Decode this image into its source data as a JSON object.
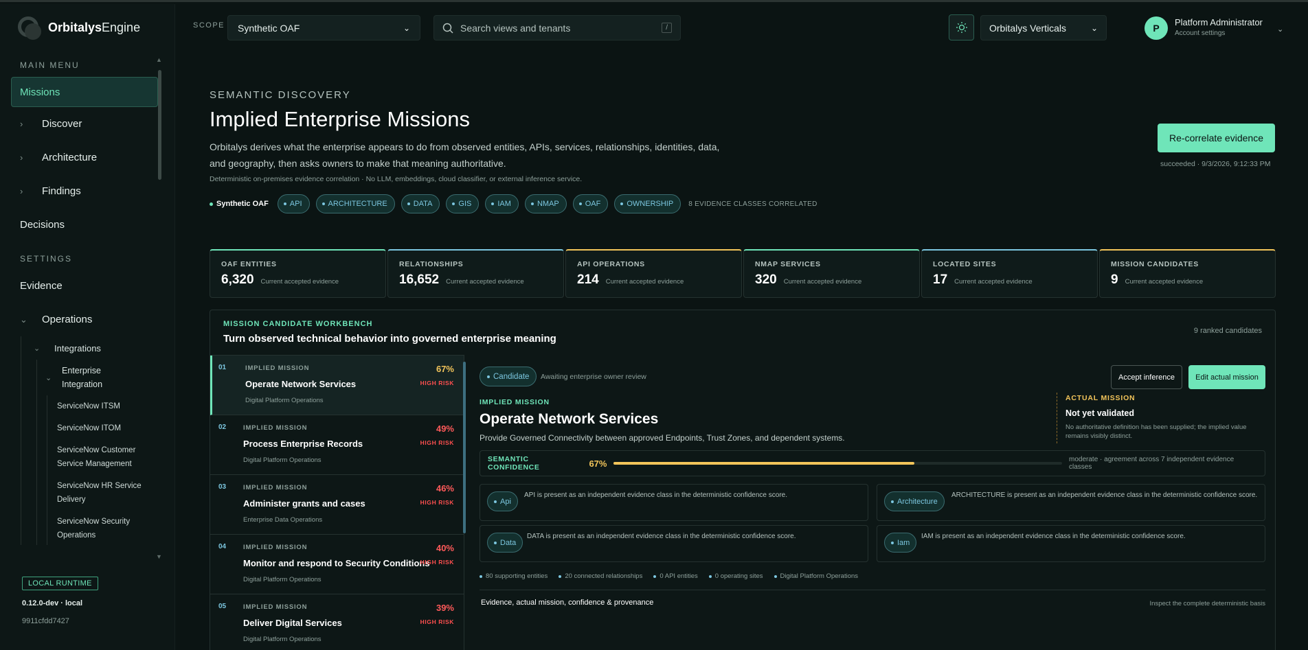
{
  "app": {
    "brand_bold": "Orbitalys",
    "brand_light": "Engine"
  },
  "sidebar": {
    "main_menu_label": "MAIN MENU",
    "settings_label": "SETTINGS",
    "items_main": [
      {
        "label": "Missions",
        "active": true
      },
      {
        "label": "Discover"
      },
      {
        "label": "Architecture"
      },
      {
        "label": "Findings"
      },
      {
        "label": "Decisions"
      }
    ],
    "evidence": "Evidence",
    "operations": "Operations",
    "integrations": "Integrations",
    "enterprise_integration": "Enterprise Integration",
    "leaves": [
      "ServiceNow ITSM",
      "ServiceNow ITOM",
      "ServiceNow Customer Service Management",
      "ServiceNow HR Service Delivery",
      "ServiceNow Security Operations"
    ],
    "runtime_badge": "LOCAL RUNTIME",
    "version": "0.12.0-dev · local",
    "hash": "9911cfdd7427"
  },
  "topbar": {
    "scope_label": "SCOPE",
    "scope_value": "Synthetic OAF",
    "search_placeholder": "Search views and tenants",
    "search_shortcut": "/",
    "vertical_value": "Orbitalys Verticals",
    "user_name": "Platform Administrator",
    "user_sub": "Account settings",
    "avatar_initial": "P"
  },
  "header": {
    "eyebrow": "SEMANTIC DISCOVERY",
    "title": "Implied Enterprise Missions",
    "description": "Orbitalys derives what the enterprise appears to do from observed entities, APIs, services, relationships, identities, data, and geography, then asks owners to make that meaning authoritative.",
    "note": "Deterministic on-premises evidence correlation · No LLM, embeddings, cloud classifier, or external inference service.",
    "scope_chip": "Synthetic OAF",
    "evidence_chips": [
      "API",
      "ARCHITECTURE",
      "DATA",
      "GIS",
      "IAM",
      "NMAP",
      "OAF",
      "OWNERSHIP"
    ],
    "evidence_count": "8 EVIDENCE CLASSES CORRELATED",
    "recorrelate_label": "Re-correlate evidence",
    "recorrelate_status": "succeeded · 9/3/2026, 9:12:33 PM"
  },
  "stats": [
    {
      "label": "OAF ENTITIES",
      "value": "6,320",
      "caption": "Current accepted evidence",
      "color": "#6fe5b9"
    },
    {
      "label": "RELATIONSHIPS",
      "value": "16,652",
      "caption": "Current accepted evidence",
      "color": "#7cc7e0"
    },
    {
      "label": "API OPERATIONS",
      "value": "214",
      "caption": "Current accepted evidence",
      "color": "#f2c45a"
    },
    {
      "label": "NMAP SERVICES",
      "value": "320",
      "caption": "Current accepted evidence",
      "color": "#6fe5b9"
    },
    {
      "label": "LOCATED SITES",
      "value": "17",
      "caption": "Current accepted evidence",
      "color": "#7cc7e0"
    },
    {
      "label": "MISSION CANDIDATES",
      "value": "9",
      "caption": "Current accepted evidence",
      "color": "#f2c45a"
    }
  ],
  "workbench": {
    "eyebrow": "MISSION CANDIDATE WORKBENCH",
    "title": "Turn observed technical behavior into governed enterprise meaning",
    "count": "9 ranked candidates",
    "candidates": [
      {
        "num": "01",
        "kind": "IMPLIED MISSION",
        "title": "Operate Network Services",
        "org": "Digital Platform Operations",
        "pct": "67%",
        "risk": "HIGH RISK",
        "pct_color": "#f2c45a"
      },
      {
        "num": "02",
        "kind": "IMPLIED MISSION",
        "title": "Process Enterprise Records",
        "org": "Digital Platform Operations",
        "pct": "49%",
        "risk": "HIGH RISK",
        "pct_color": "#ff5a5a"
      },
      {
        "num": "03",
        "kind": "IMPLIED MISSION",
        "title": "Administer grants and cases",
        "org": "Enterprise Data Operations",
        "pct": "46%",
        "risk": "HIGH RISK",
        "pct_color": "#ff5a5a"
      },
      {
        "num": "04",
        "kind": "IMPLIED MISSION",
        "title": "Monitor and respond to Security Conditions",
        "org": "Digital Platform Operations",
        "pct": "40%",
        "risk": "HIGH RISK",
        "pct_color": "#ff5a5a"
      },
      {
        "num": "05",
        "kind": "IMPLIED MISSION",
        "title": "Deliver Digital Services",
        "org": "Digital Platform Operations",
        "pct": "39%",
        "risk": "HIGH RISK",
        "pct_color": "#ff5a5a"
      }
    ]
  },
  "detail": {
    "status_pill": "Candidate",
    "status_note": "Awaiting enterprise owner review",
    "accept_label": "Accept inference",
    "edit_label": "Edit actual mission",
    "eyebrow": "IMPLIED MISSION",
    "title": "Operate Network Services",
    "description": "Provide Governed Connectivity between approved Endpoints, Trust Zones, and dependent systems.",
    "actual_label": "ACTUAL MISSION",
    "actual_value": "Not yet validated",
    "actual_note": "No authoritative definition has been supplied; the implied value remains visibly distinct.",
    "confidence_label": "SEMANTIC CONFIDENCE",
    "confidence_pct": "67%",
    "confidence_value": 0.67,
    "confidence_note": "moderate · agreement across 7 independent evidence classes",
    "evidence": [
      {
        "pill": "Api",
        "text": "API is present as an independent evidence class in the deterministic confidence score."
      },
      {
        "pill": "Architecture",
        "text": "ARCHITECTURE is present as an independent evidence class in the deterministic confidence score."
      },
      {
        "pill": "Data",
        "text": "DATA is present as an independent evidence class in the deterministic confidence score."
      },
      {
        "pill": "Iam",
        "text": "IAM is present as an independent evidence class in the deterministic confidence score."
      }
    ],
    "meta": [
      "80 supporting entities",
      "20 connected relationships",
      "0 API entities",
      "0 operating sites",
      "Digital Platform Operations"
    ],
    "provenance_label": "Evidence, actual mission, confidence & provenance",
    "provenance_link": "Inspect the complete deterministic basis"
  }
}
